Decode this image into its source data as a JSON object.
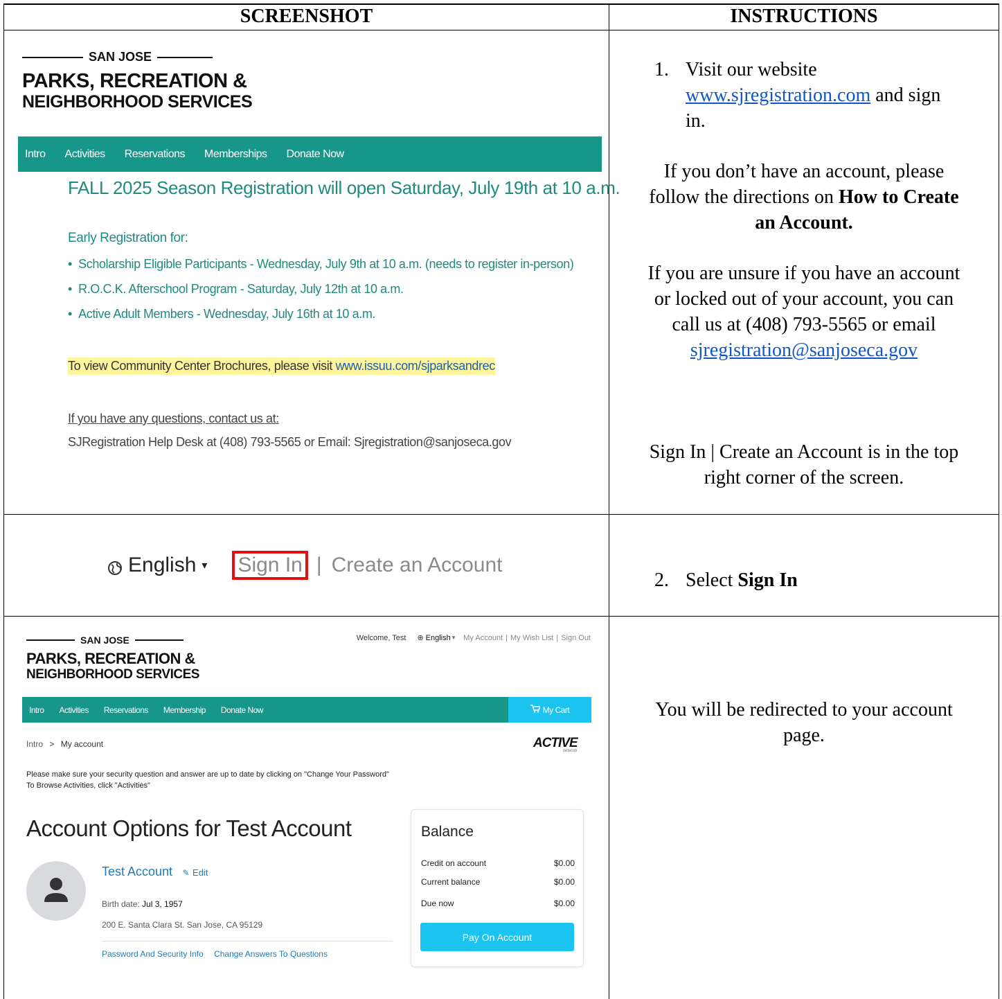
{
  "headers": {
    "screenshot": "SCREENSHOT",
    "instructions": "INSTRUCTIONS"
  },
  "logo": {
    "city": "SAN JOSE",
    "line1": "PARKS, RECREATION &",
    "line2": "NEIGHBORHOOD SERVICES"
  },
  "row1": {
    "nav": [
      "Intro",
      "Activities",
      "Reservations",
      "Memberships",
      "Donate Now"
    ],
    "headline": "FALL 2025 Season Registration will open Saturday, July 19th at 10 a.m.",
    "early_title": "Early Registration for:",
    "early_items": [
      "Scholarship Eligible Participants - Wednesday, July 9th at 10 a.m. (needs to register in-person)",
      "R.O.C.K. Afterschool Program - Saturday, July 12th at 10 a.m.",
      "Active Adult Members - Wednesday, July 16th at 10 a.m."
    ],
    "brochure_text": "To view Community Center Brochures, please visit ",
    "brochure_link": "www.issuu.com/sjparksandrec",
    "questions": "If you have any questions, contact us at:",
    "helpdesk": "SJRegistration Help Desk at (408) 793-5565 or Email: Sjregistration@sanjoseca.gov"
  },
  "instr1": {
    "num": "1.",
    "visit": "Visit our website",
    "site_link": "www.sjregistration.com",
    "visit_tail": " and sign",
    "visit_tail2": "in.",
    "no_account_a": "If you don’t have an account, please",
    "no_account_b": "follow the directions on ",
    "no_account_bold1": "How to Create",
    "no_account_bold2": "an Account.",
    "unsure_a": "If you are unsure if you have an account",
    "unsure_b": "or locked out of your account, you can",
    "unsure_c": "call us at (408) 793-5565 or email",
    "email_link": "sjregistration@sanjoseca.gov",
    "signin_a": "Sign In | Create an Account is in the top",
    "signin_b": "right corner of the screen."
  },
  "row2": {
    "language": "English",
    "signin": "Sign In",
    "separator": "|",
    "create": "Create an Account"
  },
  "instr2": {
    "num": "2.",
    "text": "Select ",
    "bold": "Sign In"
  },
  "row3": {
    "welcome": "Welcome, Test",
    "language": "English",
    "my_account": "My Account",
    "wish_list": "My Wish List",
    "sign_out": "Sign Out",
    "nav": [
      "Intro",
      "Activities",
      "Reservations",
      "Membership",
      "Donate Now"
    ],
    "cart": "My Cart",
    "breadcrumb_home": "Intro",
    "breadcrumb_sep": ">",
    "breadcrumb_current": "My account",
    "active_logo": "ACTIVE",
    "active_sub": "network",
    "notice1": "Please make sure your security question and answer are up to date by clicking on \"Change Your Password\"",
    "notice2": "To Browse Activities, click \"Activities\"",
    "title": "Account Options for Test Account",
    "name": "Test Account",
    "edit": "Edit",
    "birth_label": "Birth date: ",
    "birth_value": "Jul 3, 1957",
    "address": "200 E. Santa Clara St. San Jose, CA 95129",
    "link_password": "Password And Security Info",
    "link_answers": "Change Answers To Questions",
    "balance_title": "Balance",
    "balance_rows": [
      {
        "label": "Credit on account",
        "value": "$0.00"
      },
      {
        "label": "Current balance",
        "value": "$0.00"
      },
      {
        "label": "Due now",
        "value": "$0.00"
      }
    ],
    "pay_button": "Pay On Account"
  },
  "instr3": {
    "line1": "You will be redirected to your account",
    "line2": "page."
  },
  "colors": {
    "teal": "#17968a",
    "cyan_button": "#1bc4ef",
    "highlight": "#fff59d",
    "red_box": "#e01010"
  }
}
